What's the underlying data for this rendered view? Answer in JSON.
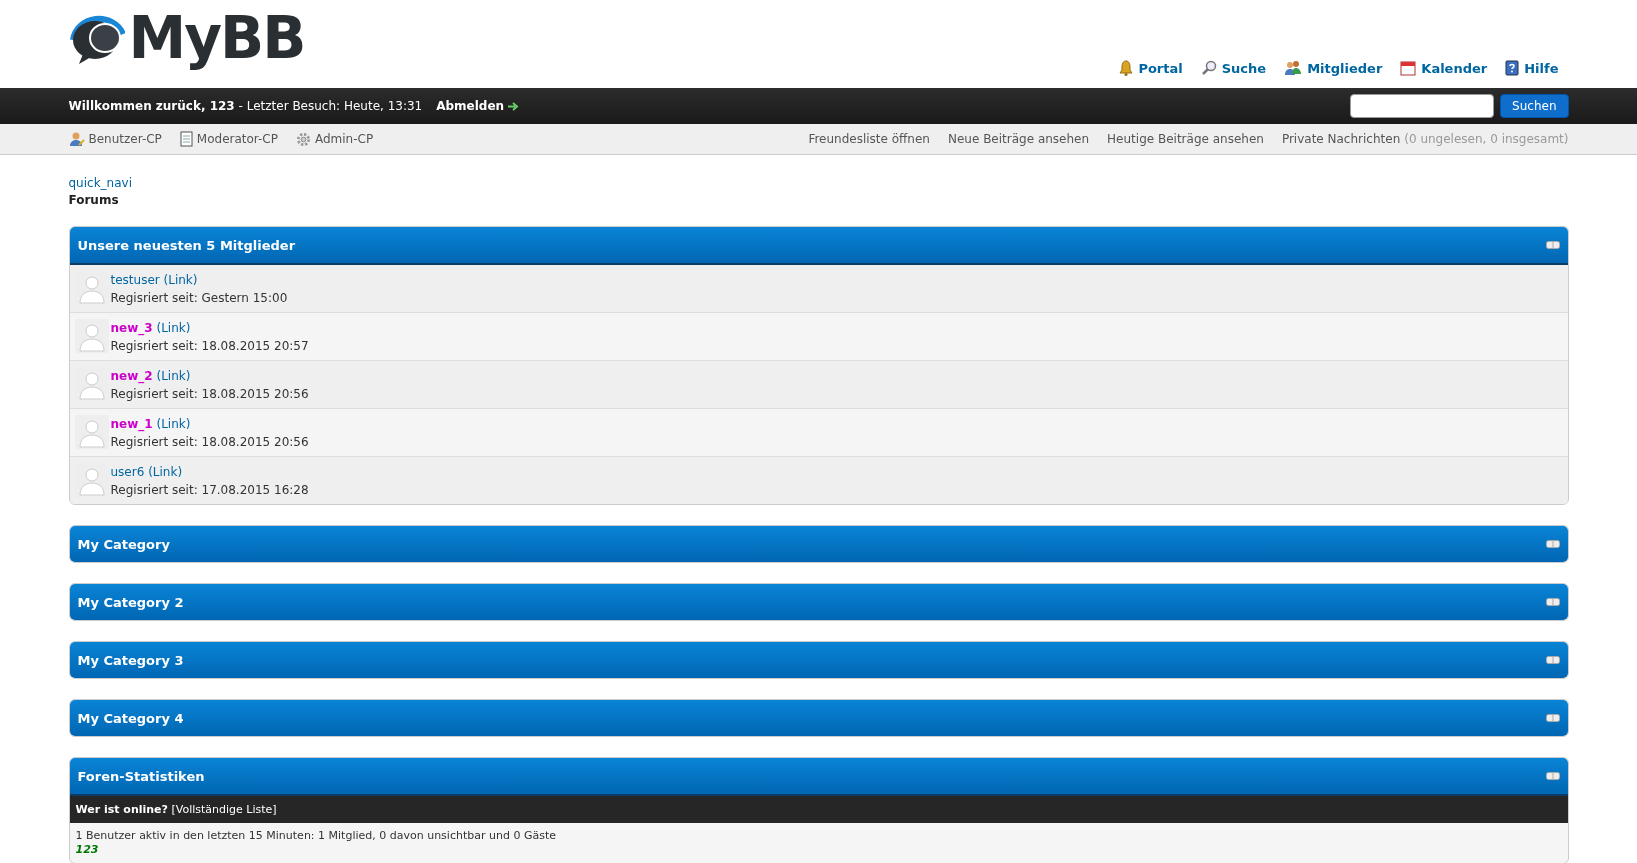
{
  "header": {
    "logo": "MyBB",
    "nav": [
      {
        "label": "Portal"
      },
      {
        "label": "Suche"
      },
      {
        "label": "Mitglieder"
      },
      {
        "label": "Kalender"
      },
      {
        "label": "Hilfe"
      }
    ]
  },
  "welcome_bar": {
    "welcome": "Willkommen zurück, 123",
    "last_visit": " - Letzter Besuch: Heute, 13:31",
    "logout": "Abmelden",
    "search_button": "Suchen"
  },
  "toolbar": {
    "left": [
      {
        "label": "Benutzer-CP"
      },
      {
        "label": "Moderator-CP"
      },
      {
        "label": "Admin-CP"
      }
    ],
    "right": [
      "Freundesliste öffnen",
      "Neue Beiträge ansehen",
      "Heutige Beiträge ansehen"
    ],
    "messages": {
      "label": "Private Nachrichten",
      "counts": "(0 ungelesen, 0 insgesamt)"
    }
  },
  "breadcrumb": {
    "link": "quick_navi",
    "current": "Forums"
  },
  "newest_members": {
    "title": "Unsere neuesten 5 Mitglieder",
    "members": [
      {
        "name": "testuser",
        "kind": "regular",
        "link": "(Link)",
        "registered": "Regisriert seit: Gestern 15:00"
      },
      {
        "name": "new_3",
        "kind": "highlighted",
        "link": "(Link)",
        "registered": "Regisriert seit: 18.08.2015 20:57"
      },
      {
        "name": "new_2",
        "kind": "highlighted",
        "link": "(Link)",
        "registered": "Regisriert seit: 18.08.2015 20:56"
      },
      {
        "name": "new_1",
        "kind": "highlighted",
        "link": "(Link)",
        "registered": "Regisriert seit: 18.08.2015 20:56"
      },
      {
        "name": "user6",
        "kind": "regular",
        "link": "(Link)",
        "registered": "Regisriert seit: 17.08.2015 16:28"
      }
    ]
  },
  "categories": [
    {
      "title": "My Category"
    },
    {
      "title": "My Category 2"
    },
    {
      "title": "My Category 3"
    },
    {
      "title": "My Category 4"
    }
  ],
  "statistics": {
    "title": "Foren-Statistiken",
    "online_heading": "Wer ist online?",
    "online_link": "[Vollständige Liste]",
    "online_text": "1 Benutzer aktiv in den letzten 15 Minuten: 1 Mitglied, 0 davon unsichtbar und 0 Gäste",
    "online_users": [
      "123"
    ]
  }
}
